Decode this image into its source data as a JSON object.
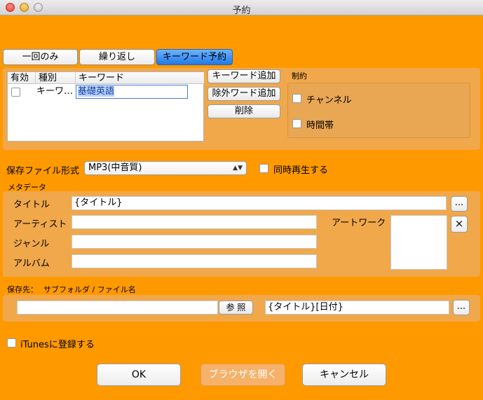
{
  "window": {
    "title": "予約"
  },
  "tabs": [
    {
      "label": "一回のみ",
      "active": false
    },
    {
      "label": "繰り返し",
      "active": false
    },
    {
      "label": "キーワード予約",
      "active": true
    }
  ],
  "keyword_table": {
    "headers": [
      "有効",
      "種別",
      "キーワード"
    ],
    "rows": [
      {
        "enabled": false,
        "type": "キーワ…",
        "keyword": "基礎英語"
      }
    ]
  },
  "keyword_buttons": {
    "add_keyword": "キーワード追加",
    "add_exclude": "除外ワード追加",
    "delete": "削除"
  },
  "restriction": {
    "title": "制約",
    "channel": "チャンネル",
    "time_slot": "時間帯"
  },
  "format": {
    "label": "保存ファイル形式",
    "selected": "MP3(中音質)",
    "simultaneous": "同時再生する"
  },
  "metadata": {
    "section": "メタデータ",
    "title_label": "タイトル",
    "title_value": "{タイトル}",
    "artist_label": "アーティスト",
    "genre_label": "ジャンル",
    "album_label": "アルバム",
    "artwork_label": "アートワーク",
    "more": "...",
    "clear": "×"
  },
  "save": {
    "section": "保存先：",
    "subfolder": "サブフォルダ / ファイル名",
    "browse": "参 照",
    "filename_value": "{タイトル}[日付}",
    "more": "..."
  },
  "itunes": {
    "label": "iTunesに登録する"
  },
  "footer": {
    "ok": "OK",
    "browser": "ブラウザを開く",
    "cancel": "キャンセル"
  }
}
